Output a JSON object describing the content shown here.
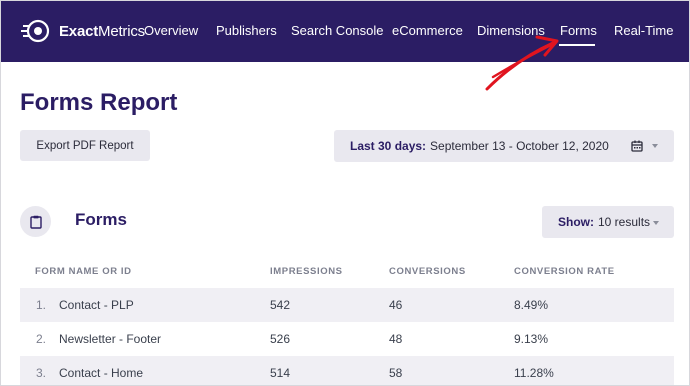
{
  "brand": {
    "bold": "Exact",
    "thin": "Metrics"
  },
  "nav": {
    "items": [
      {
        "label": "Overview"
      },
      {
        "label": "Publishers"
      },
      {
        "label": "Search Console"
      },
      {
        "label": "eCommerce"
      },
      {
        "label": "Dimensions"
      },
      {
        "label": "Forms"
      },
      {
        "label": "Real-Time"
      }
    ],
    "active": "Forms"
  },
  "page": {
    "title": "Forms Report"
  },
  "toolbar": {
    "export_label": "Export PDF Report",
    "date_prefix": "Last 30 days:",
    "date_value": "September 13 - October 12, 2020"
  },
  "section": {
    "title": "Forms",
    "show_prefix": "Show:",
    "show_value": "10 results"
  },
  "table": {
    "headers": [
      "FORM NAME OR ID",
      "IMPRESSIONS",
      "CONVERSIONS",
      "CONVERSION RATE"
    ],
    "rows": [
      {
        "index": "1.",
        "name": "Contact - PLP",
        "impressions": "542",
        "conversions": "46",
        "rate": "8.49%"
      },
      {
        "index": "2.",
        "name": "Newsletter - Footer",
        "impressions": "526",
        "conversions": "48",
        "rate": "9.13%"
      },
      {
        "index": "3.",
        "name": "Contact - Home",
        "impressions": "514",
        "conversions": "58",
        "rate": "11.28%"
      }
    ]
  },
  "colors": {
    "nav_bg": "#2b1d64",
    "title": "#2b1d64",
    "control_bg": "#e9e8ef",
    "row_shade": "#f0eff4",
    "annotation": "#e0141f"
  }
}
